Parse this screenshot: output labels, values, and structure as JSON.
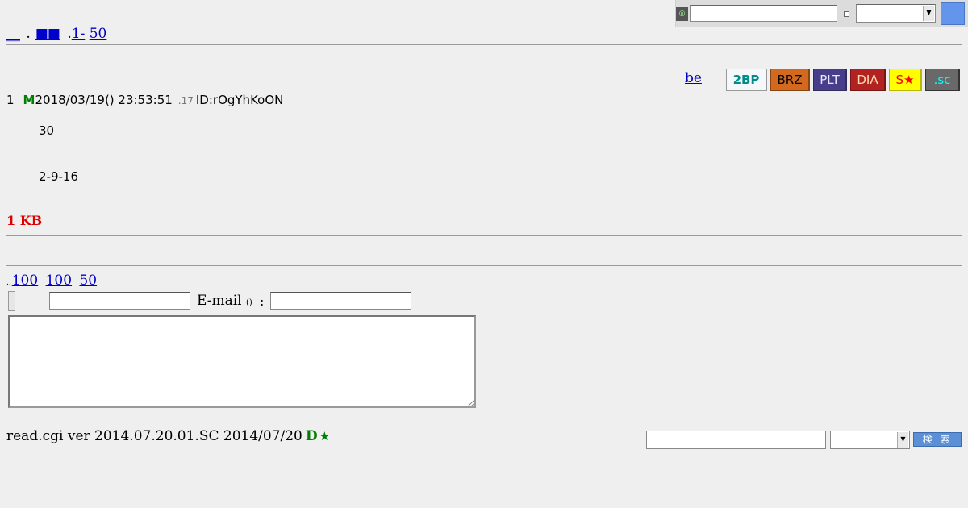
{
  "search_bar": {
    "icon": "target-icon",
    "icon_glyph": "◎",
    "query": "",
    "checkbox_checked": false,
    "select_value": ""
  },
  "nav": {
    "link1": "__",
    "link2": "■■",
    "link3": "1-",
    "link4": "50"
  },
  "badges": {
    "be": "be",
    "items": [
      {
        "label": "2BP",
        "bg": "#f5f8fb",
        "fg": "#008b8b",
        "border": "#999999"
      },
      {
        "label": "BRZ",
        "bg": "#d2691e",
        "fg": "#000000",
        "border": "#8b4513"
      },
      {
        "label": "PLT",
        "bg": "#483d8b",
        "fg": "#e6e6fa",
        "border": "#2f2f5f"
      },
      {
        "label": "DIA",
        "bg": "#b22222",
        "fg": "#ffdead",
        "border": "#7a1515"
      },
      {
        "label": "S★",
        "bg": "#ffff00",
        "fg": "#ff0000",
        "border": "#b8b800"
      },
      {
        "label": ".sc",
        "bg": "#696969",
        "fg": "#00ffff",
        "border": "#333333"
      }
    ]
  },
  "post": {
    "number": "1",
    "mail": "M",
    "datetime": "2018/03/19() 23:53:51",
    "small": ".17",
    "id": "ID:rOgYhKoON",
    "lines": [
      "30",
      "2-9-16"
    ]
  },
  "size": "1 KB",
  "footer_nav": {
    "dots": "..",
    "link1": "100",
    "link2": "100",
    "link3": "50"
  },
  "form": {
    "name_value": "",
    "email_label": "E-mail",
    "email_note": "()",
    "colon": ":",
    "email_value": "",
    "message": ""
  },
  "footer": {
    "version": "read.cgi ver 2014.07.20.01.SC 2014/07/20",
    "d": "D",
    "star": "★",
    "search_button": "検 索",
    "search_value": "",
    "select_value": ""
  },
  "colors": {
    "link": "#0000cc",
    "size_label": "#e00000",
    "green": "#008000",
    "search_button": "#5b8fd6"
  }
}
